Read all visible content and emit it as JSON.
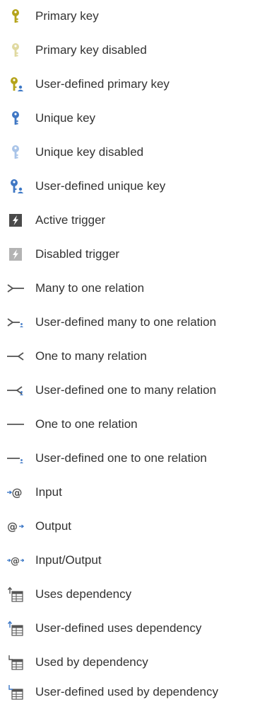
{
  "legend": {
    "items": [
      {
        "label": "Primary key",
        "icon": "primary-key-icon"
      },
      {
        "label": "Primary key disabled",
        "icon": "primary-key-disabled-icon"
      },
      {
        "label": "User-defined primary key",
        "icon": "user-defined-primary-key-icon"
      },
      {
        "label": "Unique key",
        "icon": "unique-key-icon"
      },
      {
        "label": "Unique key disabled",
        "icon": "unique-key-disabled-icon"
      },
      {
        "label": "User-defined unique key",
        "icon": "user-defined-unique-key-icon"
      },
      {
        "label": "Active trigger",
        "icon": "active-trigger-icon"
      },
      {
        "label": "Disabled trigger",
        "icon": "disabled-trigger-icon"
      },
      {
        "label": "Many to one relation",
        "icon": "many-to-one-relation-icon"
      },
      {
        "label": "User-defined many to one relation",
        "icon": "user-defined-many-to-one-relation-icon"
      },
      {
        "label": "One to many relation",
        "icon": "one-to-many-relation-icon"
      },
      {
        "label": "User-defined one to many relation",
        "icon": "user-defined-one-to-many-relation-icon"
      },
      {
        "label": "One to one relation",
        "icon": "one-to-one-relation-icon"
      },
      {
        "label": "User-defined one to one relation",
        "icon": "user-defined-one-to-one-relation-icon"
      },
      {
        "label": "Input",
        "icon": "input-parameter-icon"
      },
      {
        "label": "Output",
        "icon": "output-parameter-icon"
      },
      {
        "label": "Input/Output",
        "icon": "input-output-parameter-icon"
      },
      {
        "label": "Uses dependency",
        "icon": "uses-dependency-icon"
      },
      {
        "label": "User-defined uses dependency",
        "icon": "user-defined-uses-dependency-icon"
      },
      {
        "label": "Used by dependency",
        "icon": "used-by-dependency-icon"
      },
      {
        "label": "User-defined used by dependency",
        "icon": "user-defined-used-by-dependency-icon"
      }
    ]
  },
  "colors": {
    "primary_key": "#b5a31a",
    "primary_key_disabled": "#e0d9a0",
    "unique_key": "#3f77c4",
    "unique_key_disabled": "#a9c4e8",
    "user_badge": "#3d78c6",
    "trigger_active": "#4a4a4a",
    "trigger_disabled": "#b3b3b3",
    "relation_line": "#555555",
    "parameter_at": "#555555",
    "parameter_arrow": "#3d78c6",
    "text": "#333333"
  }
}
